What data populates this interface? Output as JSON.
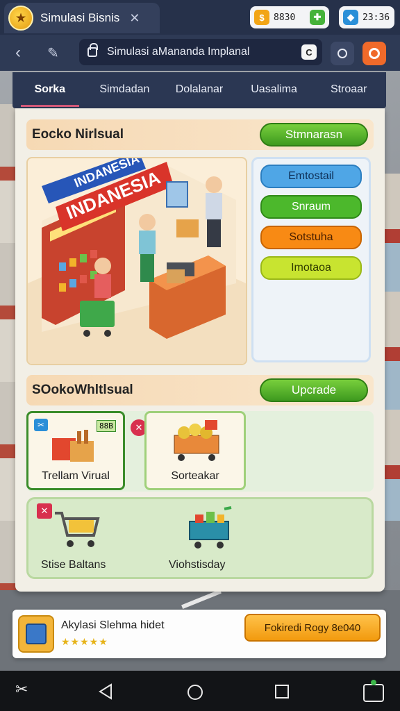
{
  "app": {
    "title": "Simulasi Bisnis",
    "close_icon": "close-icon"
  },
  "counters": [
    {
      "value": "8830",
      "icon": "coin-icon",
      "color": "#f2a516"
    },
    {
      "value": "23:36",
      "icon": "gem-icon",
      "color": "#2a8fd8"
    }
  ],
  "browser": {
    "url_text": "Simulasi aMananda Implanal"
  },
  "tabs": [
    {
      "label": "Sorka"
    },
    {
      "label": "Simdadan"
    },
    {
      "label": "Dolalanar"
    },
    {
      "label": "Uasalima"
    },
    {
      "label": "Stroaar"
    }
  ],
  "store_section": {
    "title": "Eocko Nirlsual",
    "action_label": "Stmnarasn",
    "scene_sign": "INDANESIA",
    "scene_banner": "INDANESIA"
  },
  "side_options": [
    {
      "label": "Emtostail",
      "color": "#4fa6e6",
      "text_color": "#0d2e55"
    },
    {
      "label": "Snraum",
      "color": "#4cb82c",
      "text_color": "#ffffff"
    },
    {
      "label": "Sotstuha",
      "color": "#f88a14",
      "text_color": "#4a2000"
    },
    {
      "label": "Imotaoa",
      "color": "#c8e430",
      "text_color": "#2f3a00"
    }
  ],
  "upgrade_section": {
    "title": "SOokoWhltlsual",
    "action_label": "Upcrade"
  },
  "cards": [
    {
      "label": "Trellam Virual",
      "badge": "88B"
    },
    {
      "label": "Sorteakar"
    }
  ],
  "bottom_items": [
    {
      "label": "Stise Baltans"
    },
    {
      "label": "Viohstisday"
    }
  ],
  "ad": {
    "title": "Akylasi Slehma hidet",
    "rating": "★★★★★",
    "button_label": "Fokiredi Rogy 8e040"
  }
}
